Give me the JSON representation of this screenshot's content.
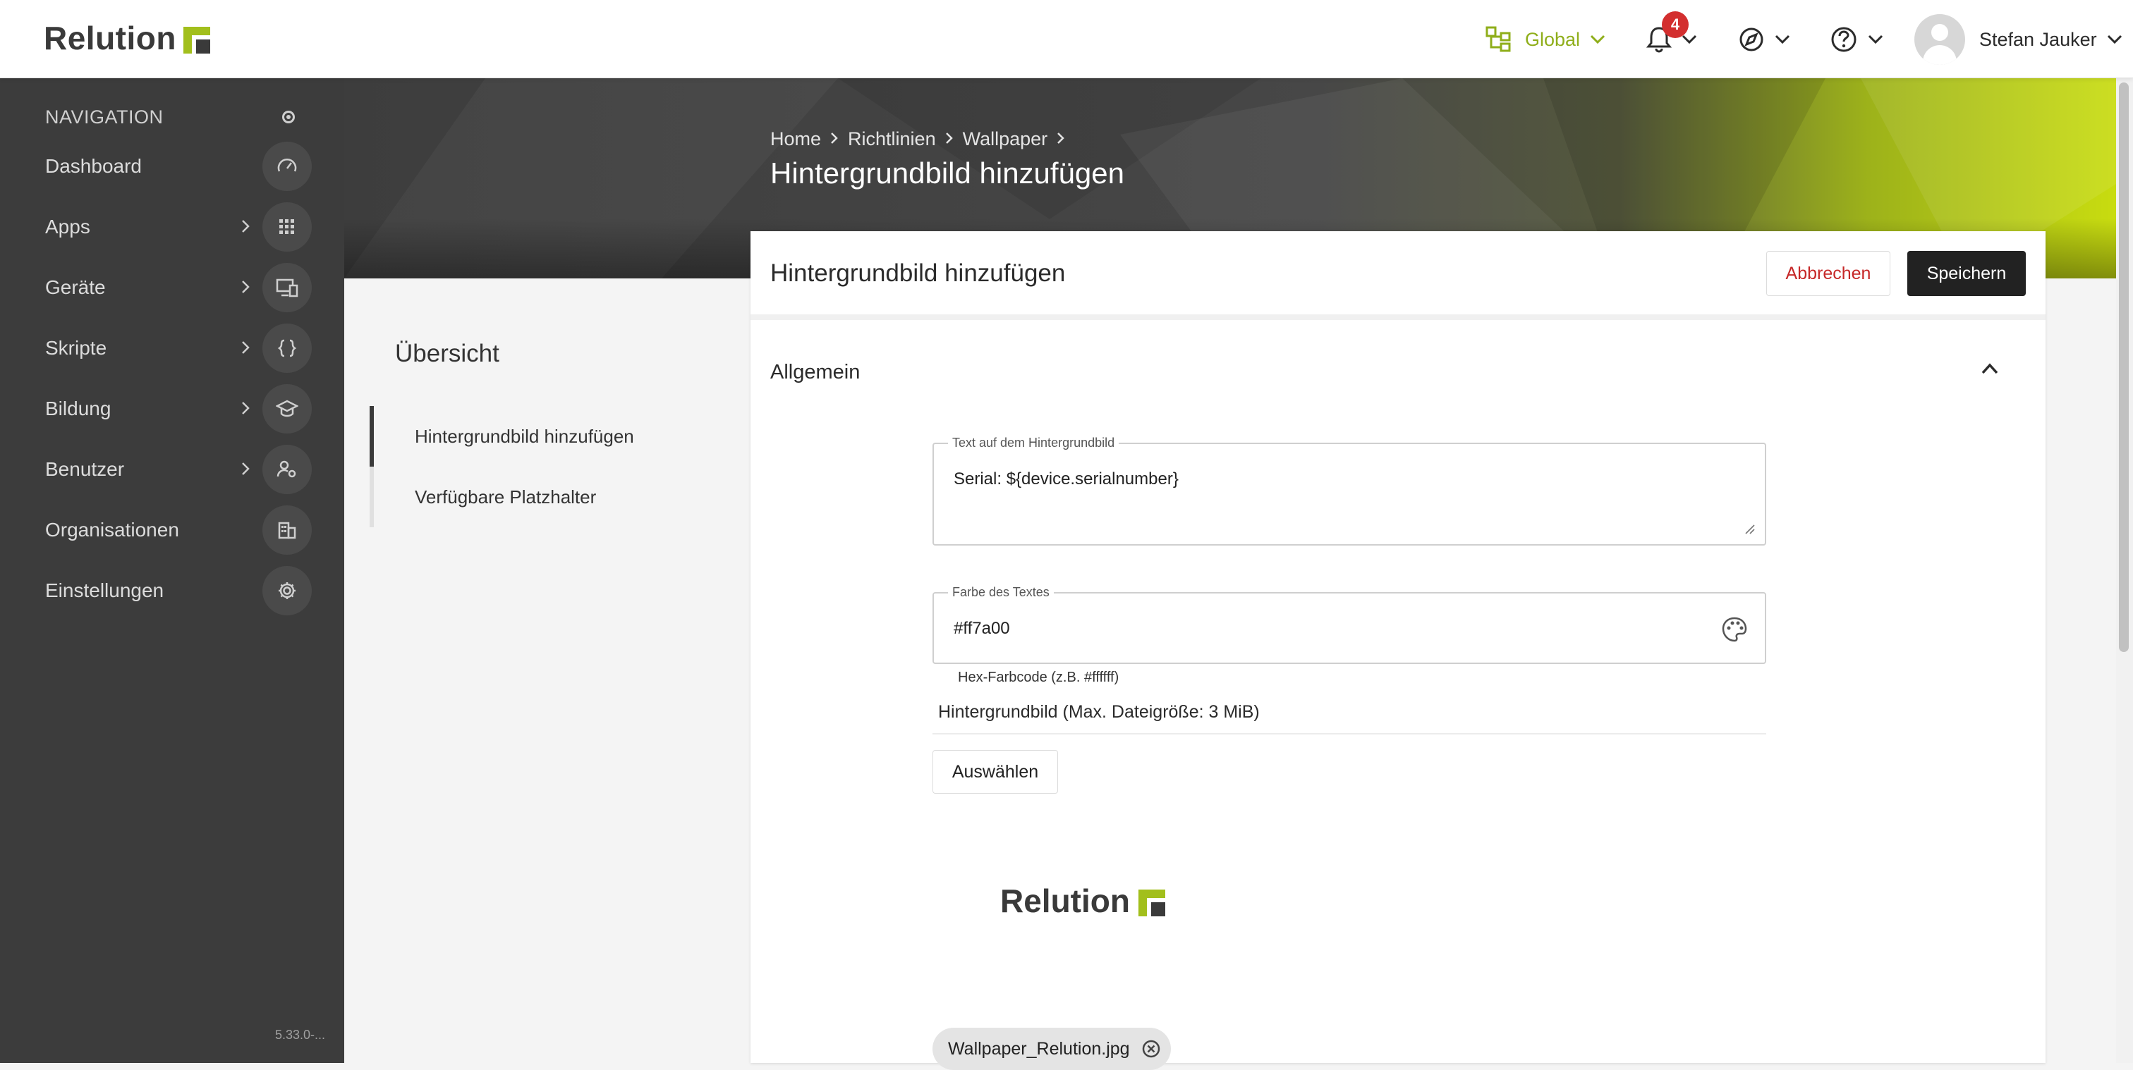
{
  "header": {
    "brand": "Relution",
    "scope_label": "Global",
    "notifications_count": "4",
    "user_name": "Stefan Jauker"
  },
  "sidebar": {
    "title": "NAVIGATION",
    "items": [
      {
        "label": "Dashboard",
        "icon": "gauge-icon",
        "expandable": false
      },
      {
        "label": "Apps",
        "icon": "grid-icon",
        "expandable": true
      },
      {
        "label": "Geräte",
        "icon": "devices-icon",
        "expandable": true
      },
      {
        "label": "Skripte",
        "icon": "code-braces-icon",
        "expandable": true
      },
      {
        "label": "Bildung",
        "icon": "graduation-cap-icon",
        "expandable": true
      },
      {
        "label": "Benutzer",
        "icon": "users-icon",
        "expandable": true
      },
      {
        "label": "Organisationen",
        "icon": "building-icon",
        "expandable": false
      },
      {
        "label": "Einstellungen",
        "icon": "gear-icon",
        "expandable": false
      }
    ],
    "version": "5.33.0-..."
  },
  "breadcrumb": [
    "Home",
    "Richtlinien",
    "Wallpaper"
  ],
  "page_title": "Hintergrundbild hinzufügen",
  "overview": {
    "title": "Übersicht",
    "items": [
      "Hintergrundbild hinzufügen",
      "Verfügbare Platzhalter"
    ]
  },
  "card": {
    "title": "Hintergrundbild hinzufügen",
    "cancel_label": "Abbrechen",
    "save_label": "Speichern",
    "section_title": "Allgemein",
    "text_field": {
      "label": "Text auf dem Hintergrundbild",
      "value": "Serial: ${device.serialnumber}"
    },
    "color_field": {
      "label": "Farbe des Textes",
      "value": "#ff7a00",
      "hint": "Hex-Farbcode (z.B. #ffffff)"
    },
    "image_label": "Hintergrundbild (Max. Dateigröße: 3 MiB)",
    "select_label": "Auswählen",
    "preview_text": "Relution",
    "file_chip": "Wallpaper_Relution.jpg"
  },
  "colors": {
    "accent_green": "#a2bf1c",
    "sidebar_bg": "#3c3c3c",
    "cancel_red": "#c62828",
    "badge_red": "#d32f2f"
  }
}
